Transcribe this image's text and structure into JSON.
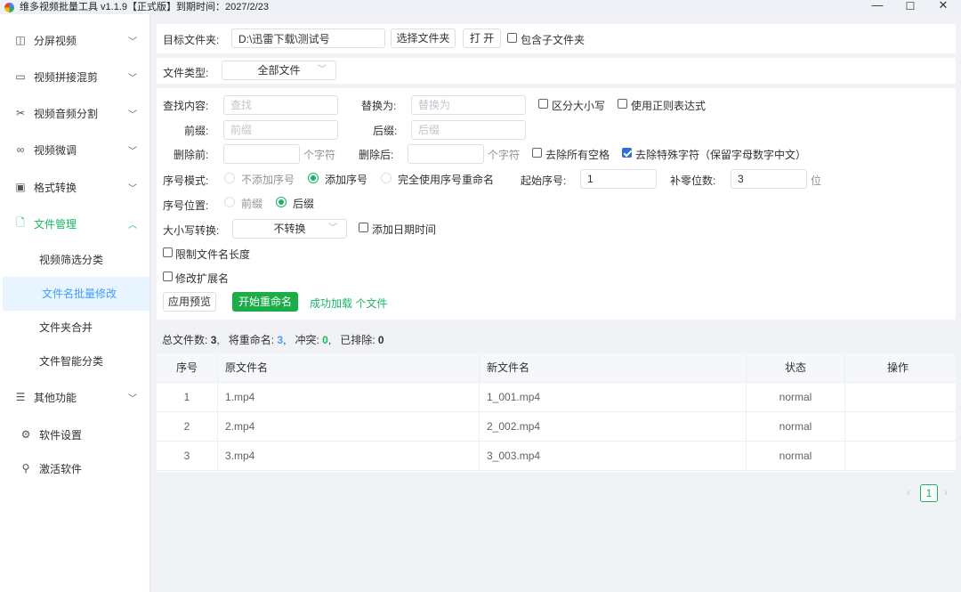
{
  "window": {
    "title": "维多视频批量工具 v1.1.9【正式版】到期时间：2027/2/23",
    "min": "—",
    "max": "☐",
    "close": "✕"
  },
  "sidebar": {
    "items": [
      {
        "label": "分屏视频",
        "icon": "split-screen-icon"
      },
      {
        "label": "视频拼接混剪",
        "icon": "film-strip-icon"
      },
      {
        "label": "视频音频分割",
        "icon": "scissors-icon"
      },
      {
        "label": "视频微调",
        "icon": "link-icon"
      },
      {
        "label": "格式转换",
        "icon": "convert-icon"
      },
      {
        "label": "文件管理",
        "icon": "file-icon"
      },
      {
        "label": "其他功能",
        "icon": "menu-icon"
      }
    ],
    "sub_items": [
      "视频筛选分类",
      "文件名批量修改",
      "文件夹合并",
      "文件智能分类"
    ],
    "bottom_items": [
      {
        "label": "软件设置",
        "icon": "gear-icon"
      },
      {
        "label": "激活软件",
        "icon": "search-icon"
      }
    ]
  },
  "target": {
    "label": "目标文件夹:",
    "path": "D:\\迅雷下载\\测试号",
    "choose_button": "选择文件夹",
    "open_button": "打 开",
    "include_sub_label": "包含子文件夹"
  },
  "filetype": {
    "label": "文件类型:",
    "value": "全部文件"
  },
  "form": {
    "find_label": "查找内容:",
    "find_placeholder": "查找",
    "replace_label": "替换为:",
    "replace_placeholder": "替换为",
    "case_label": "区分大小写",
    "regex_label": "使用正则表达式",
    "prefix_label": "前缀:",
    "prefix_placeholder": "前缀",
    "suffix_label": "后缀:",
    "suffix_placeholder": "后缀",
    "del_front_label": "删除前:",
    "del_front_unit": "个字符",
    "del_back_label": "删除后:",
    "del_back_unit": "个字符",
    "remove_spaces_label": "去除所有空格",
    "remove_special_label": "去除特殊字符（保留字母数字中文）",
    "seq_mode_label": "序号模式:",
    "seq_mode_options": [
      "不添加序号",
      "添加序号",
      "完全使用序号重命名"
    ],
    "start_seq_label": "起始序号:",
    "start_seq_value": "1",
    "pad_label": "补零位数:",
    "pad_value": "3",
    "pad_unit": "位",
    "seq_pos_label": "序号位置:",
    "seq_pos_options": [
      "前缀",
      "后缀"
    ],
    "case_conv_label": "大小写转换:",
    "case_conv_value": "不转换",
    "add_date_label": "添加日期时间",
    "limit_len_label": "限制文件名长度",
    "modify_ext_label": "修改扩展名",
    "preview_button": "应用预览",
    "start_button": "开始重命名",
    "status_msg": "成功加载 个文件"
  },
  "summary": {
    "total_label": "总文件数:",
    "total": "3",
    "rename_label": "将重命名:",
    "rename": "3",
    "conflict_label": "冲突:",
    "conflict": "0",
    "excluded_label": "已排除:",
    "excluded": "0"
  },
  "table": {
    "headers": [
      "序号",
      "原文件名",
      "新文件名",
      "状态",
      "操作"
    ],
    "rows": [
      [
        "1",
        "1.mp4",
        "1_001.mp4",
        "normal",
        ""
      ],
      [
        "2",
        "2.mp4",
        "2_002.mp4",
        "normal",
        ""
      ],
      [
        "3",
        "3.mp4",
        "3_003.mp4",
        "normal",
        ""
      ]
    ]
  },
  "pagination": {
    "prev": "‹",
    "current": "1",
    "next": "›"
  },
  "colors": {
    "accent_green": "#18b566",
    "selected_blue": "#409eff",
    "checkbox_blue": "#2f6fd6"
  }
}
